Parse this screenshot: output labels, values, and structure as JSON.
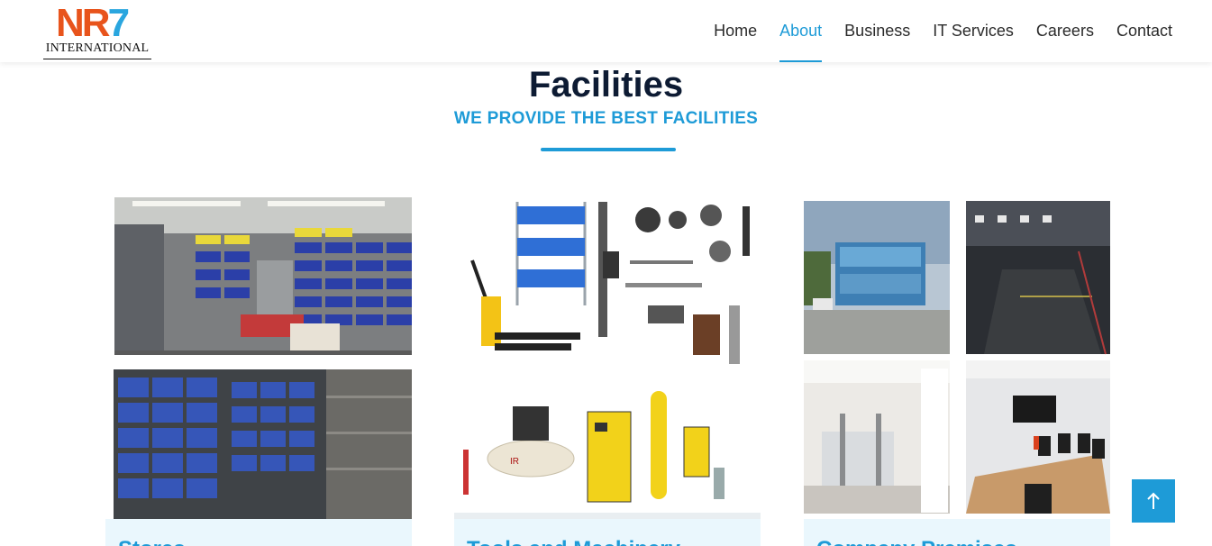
{
  "brand": {
    "logo_mark_left": "NR",
    "logo_mark_right": "7",
    "logo_word": "INTERNATIONAL"
  },
  "nav": {
    "items": [
      {
        "label": "Home"
      },
      {
        "label": "About",
        "active": true
      },
      {
        "label": "Business"
      },
      {
        "label": "IT Services"
      },
      {
        "label": "Careers"
      },
      {
        "label": "Contact"
      }
    ]
  },
  "section": {
    "title": "Facilities",
    "subtitle": "WE PROVIDE THE BEST FACILITIES"
  },
  "cards": [
    {
      "caption": "Stores",
      "image": "warehouse-storage-bins"
    },
    {
      "caption": "Tools and Machinery",
      "image": "tools-equipment"
    },
    {
      "caption": "Company Premises",
      "image": "company-premises"
    }
  ],
  "colors": {
    "accent": "#1e9bd7",
    "heading": "#0d1b33",
    "logo_orange": "#e8541c",
    "caption_bg": "#eaf7fd"
  },
  "back_to_top": {
    "icon": "arrow-up-icon"
  }
}
